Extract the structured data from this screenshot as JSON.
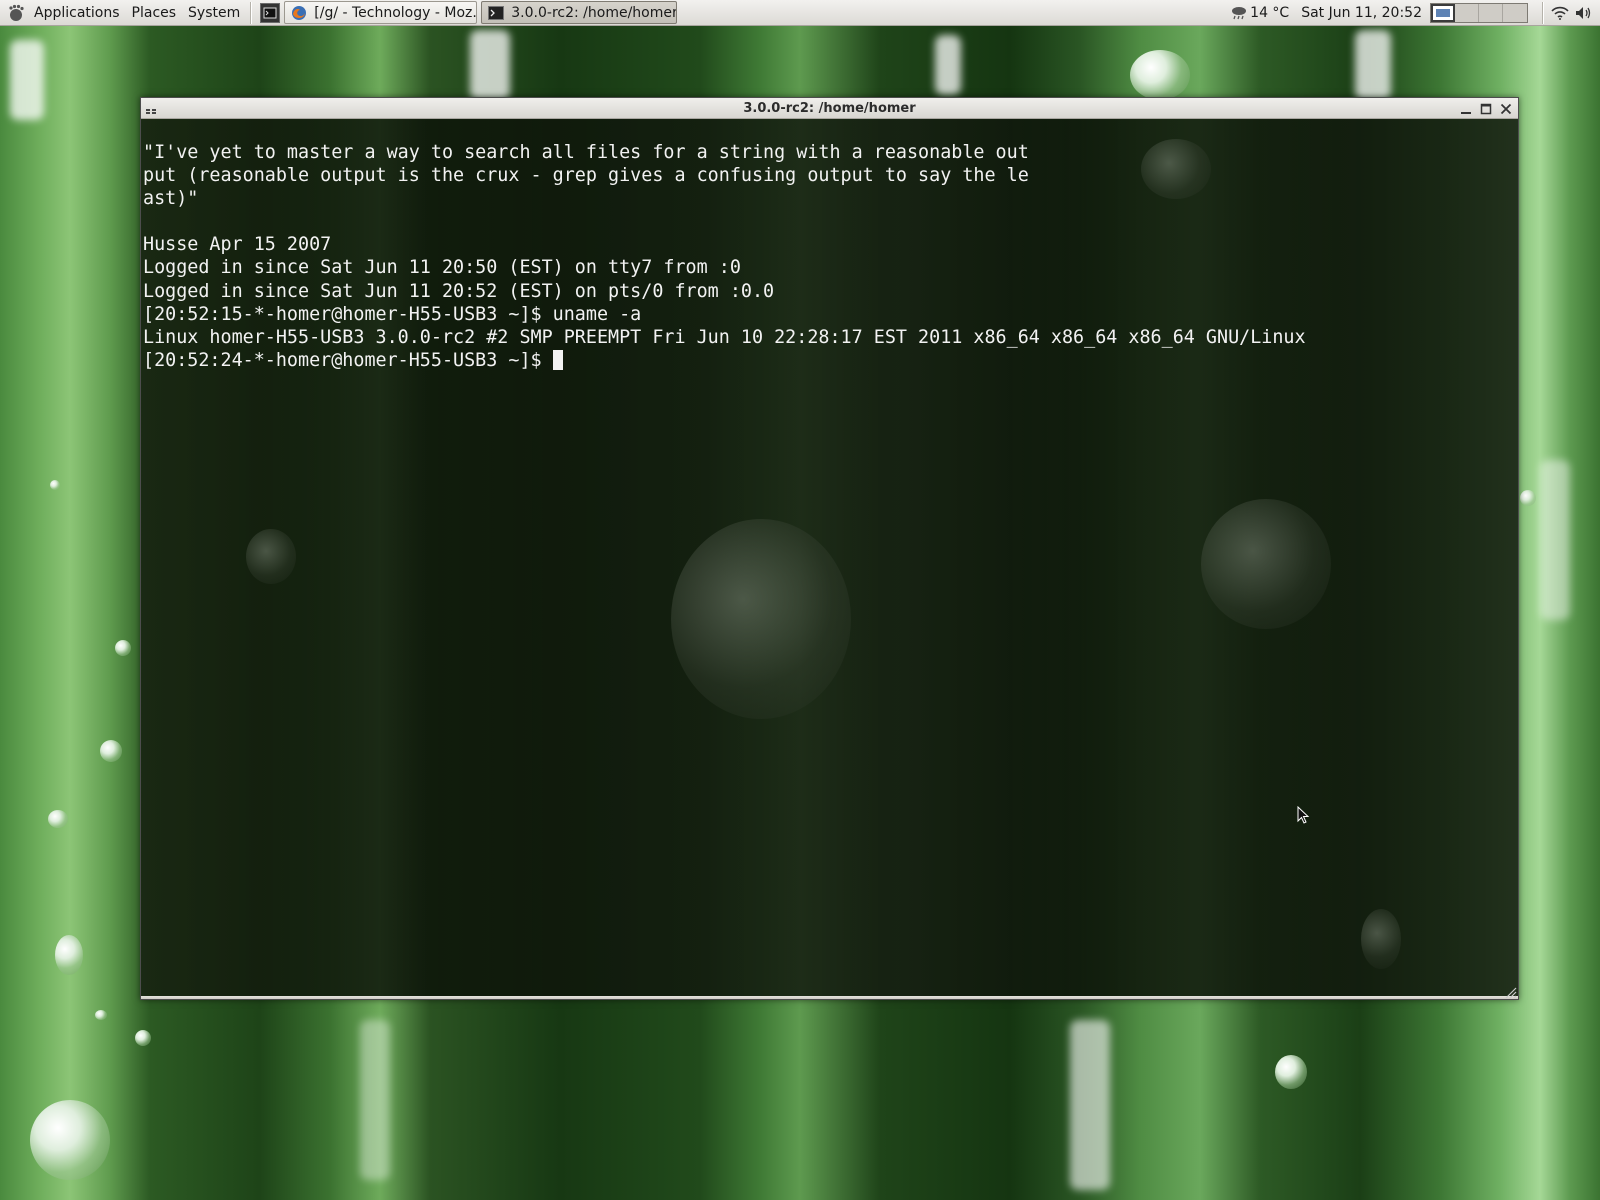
{
  "panel": {
    "menus": [
      "Applications",
      "Places",
      "System"
    ],
    "tasks": [
      {
        "label": "[/g/ - Technology - Moz...",
        "icon": "firefox-icon"
      },
      {
        "label": "3.0.0-rc2: /home/homer",
        "icon": "terminal-icon"
      }
    ],
    "weather": "14 °C",
    "clock": "Sat Jun 11, 20:52"
  },
  "terminal": {
    "title": "3.0.0-rc2: /home/homer",
    "lines": [
      "\"I've yet to master a way to search all files for a string with a reasonable out",
      "put (reasonable output is the crux - grep gives a confusing output to say the le",
      "ast)\"",
      "",
      "Husse Apr 15 2007",
      "Logged in since Sat Jun 11 20:50 (EST) on tty7 from :0",
      "Logged in since Sat Jun 11 20:52 (EST) on pts/0 from :0.0",
      "[20:52:15-*-homer@homer-H55-USB3 ~]$ uname -a",
      "Linux homer-H55-USB3 3.0.0-rc2 #2 SMP PREEMPT Fri Jun 10 22:28:17 EST 2011 x86_64 x86_64 x86_64 GNU/Linux"
    ],
    "prompt": "[20:52:24-*-homer@homer-H55-USB3 ~]$ "
  },
  "colors": {
    "terminal_fg": "#f2f2f2",
    "panel_bg": "#dcdad5"
  }
}
